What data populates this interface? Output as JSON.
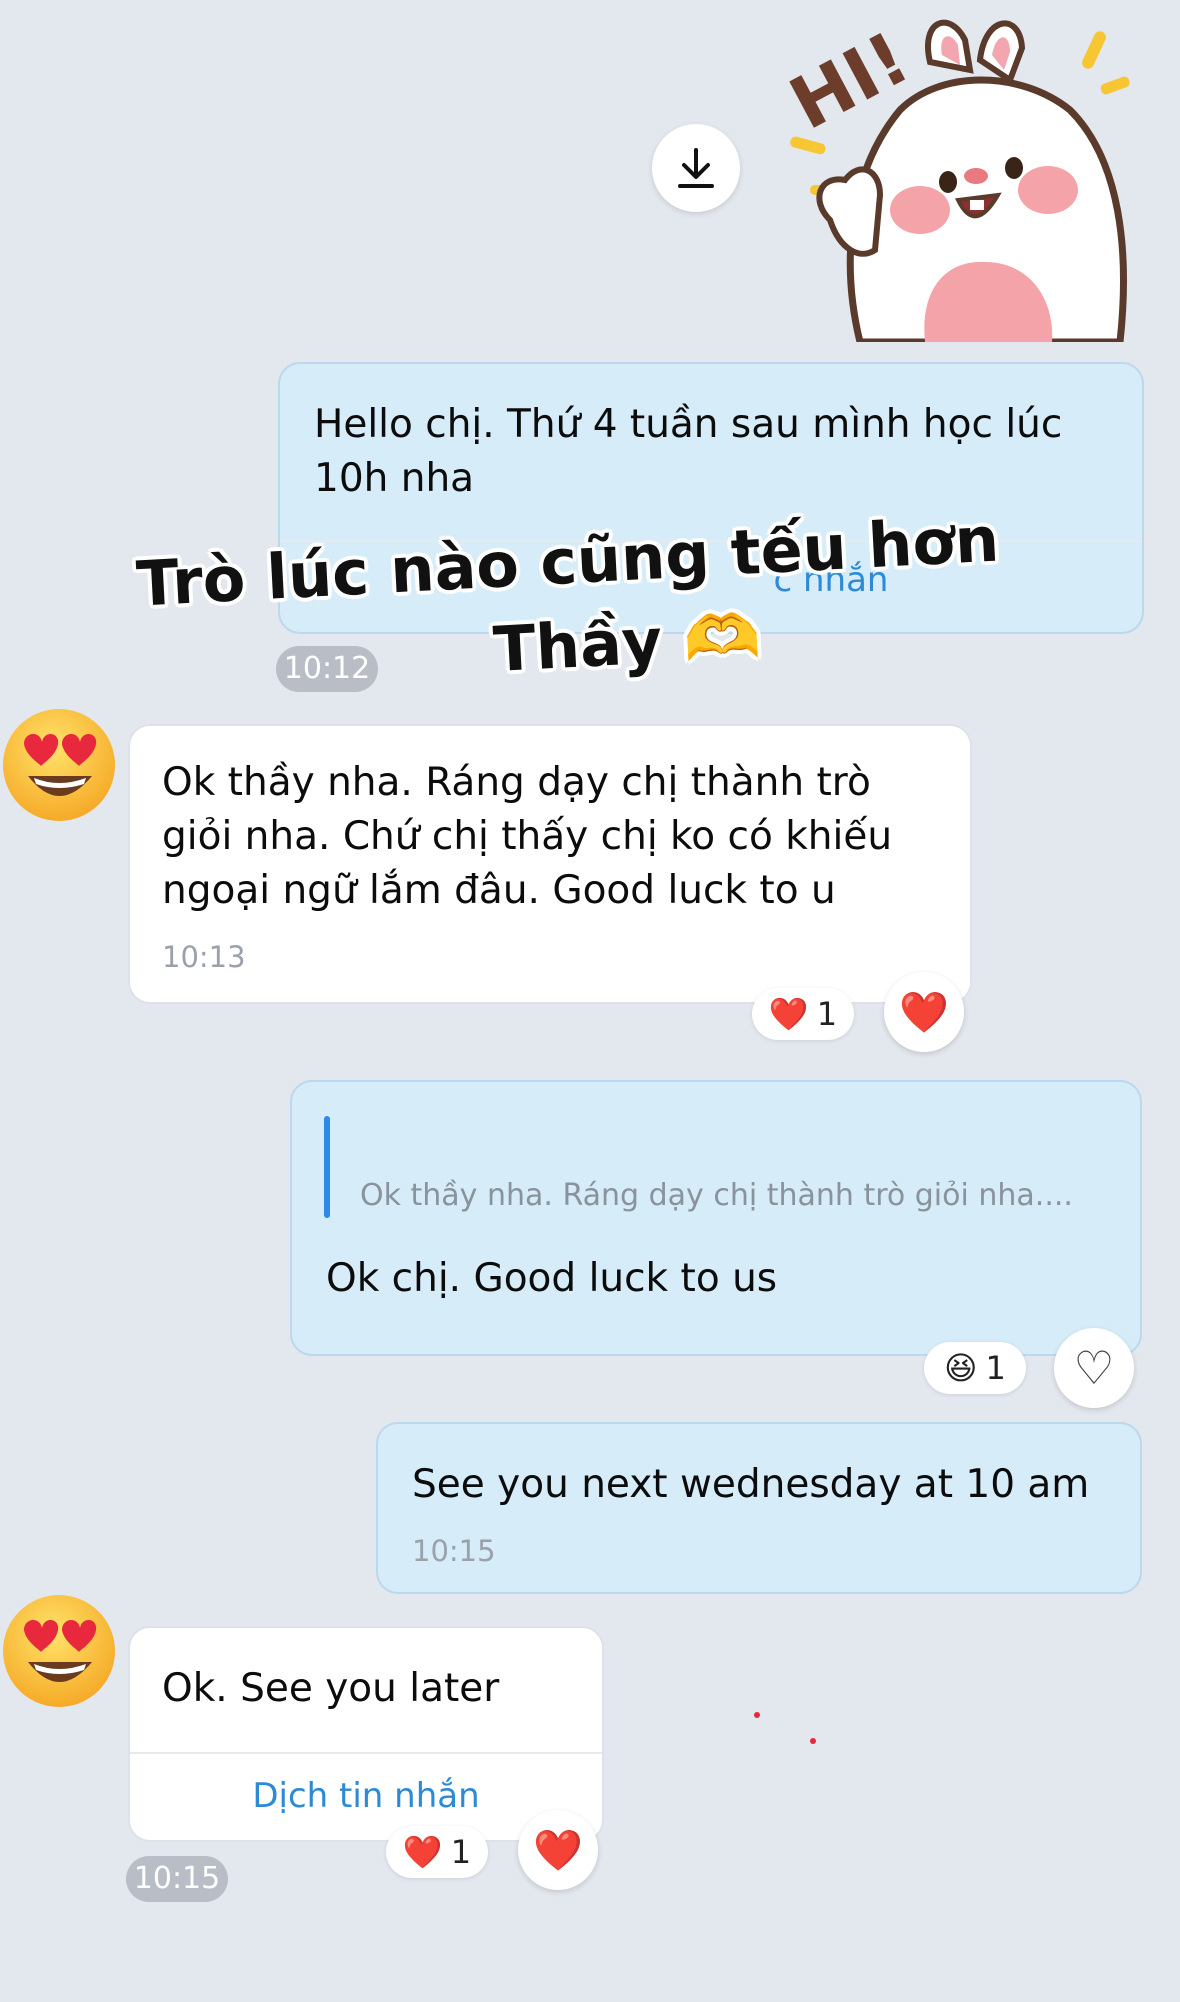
{
  "messages": [
    {
      "direction": "out",
      "text": "Hello chị. Thứ 4 tuần sau mình học lúc 10h nha",
      "footer_partial": "c nhắn",
      "time": "10:12"
    },
    {
      "direction": "in",
      "text": "Ok thầy nha. Ráng dạy chị thành trò giỏi nha. Chứ chị thấy chị ko có khiếu ngoại ngữ lắm đâu. Good luck to u",
      "time": "10:13",
      "reaction": {
        "emoji": "❤️",
        "count": "1"
      },
      "react_button": "❤️"
    },
    {
      "direction": "out",
      "quote": "Ok thầy nha. Ráng dạy chị thành trò giỏi nha....",
      "text": "Ok chị. Good luck to us",
      "reaction": {
        "emoji": "😆",
        "count": "1"
      },
      "react_button": "♡"
    },
    {
      "direction": "out",
      "text": "See you next wednesday at 10 am",
      "time": "10:15"
    },
    {
      "direction": "in",
      "text": "Ok. See you later",
      "translate": "Dịch tin nhắn",
      "time": "10:15",
      "reaction": {
        "emoji": "❤️",
        "count": "1"
      },
      "react_button": "❤️"
    }
  ],
  "overlay": {
    "line1": "Trò lúc nào cũng tếu hơn",
    "line2": "Thầy 🫶"
  },
  "sticker": {
    "text": "HI!",
    "icon": "bunny-hi-sticker"
  },
  "avatar": {
    "emoji": "😍"
  },
  "icons": {
    "download": "download-icon"
  },
  "colors": {
    "background": "#e3e7ee",
    "outgoing_bubble": "#d6ecf9",
    "incoming_bubble": "#ffffff",
    "link": "#2d8ad6",
    "heart": "#e8283c"
  }
}
